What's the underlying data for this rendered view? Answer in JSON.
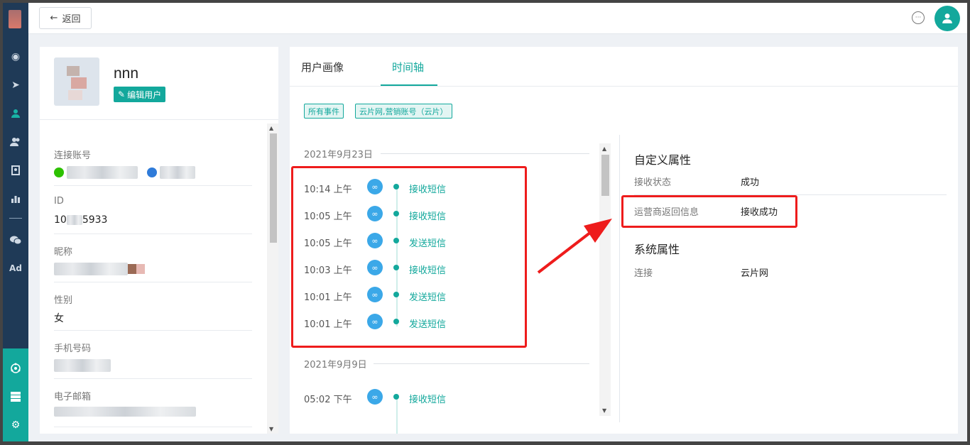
{
  "topbar": {
    "back_label": "返回"
  },
  "profile": {
    "name": "nnn",
    "edit_label": "编辑用户",
    "fields": [
      {
        "label": "连接账号",
        "value": ""
      },
      {
        "label": "ID",
        "value": "10",
        "value_tail": "5933"
      },
      {
        "label": "昵称",
        "value": ""
      },
      {
        "label": "性别",
        "value": "女"
      },
      {
        "label": "手机号码",
        "value": ""
      },
      {
        "label": "电子邮箱",
        "value": ""
      }
    ]
  },
  "main": {
    "tabs": [
      {
        "label": "用户画像"
      },
      {
        "label": "时间轴"
      }
    ],
    "active_tab": "时间轴",
    "tags": [
      "所有事件",
      "云片网,营销账号（云片）"
    ],
    "groups": [
      {
        "date": "2021年9月23日",
        "events": [
          {
            "time": "10:14 上午",
            "label": "接收短信"
          },
          {
            "time": "10:05 上午",
            "label": "接收短信"
          },
          {
            "time": "10:05 上午",
            "label": "发送短信"
          },
          {
            "time": "10:03 上午",
            "label": "接收短信"
          },
          {
            "time": "10:01 上午",
            "label": "发送短信"
          },
          {
            "time": "10:01 上午",
            "label": "发送短信"
          }
        ]
      },
      {
        "date": "2021年9月9日",
        "events": [
          {
            "time": "05:02 下午",
            "label": "接收短信"
          }
        ]
      }
    ],
    "custom_props": {
      "title": "自定义属性",
      "rows": [
        {
          "key": "接收状态",
          "value": "成功"
        },
        {
          "key": "运营商返回信息",
          "value": "接收成功"
        }
      ]
    },
    "system_props": {
      "title": "系统属性",
      "rows": [
        {
          "key": "连接",
          "value": "云片网"
        }
      ]
    }
  },
  "colors": {
    "accent": "#13a89c",
    "nav": "#1f3a57",
    "highlight": "#ee1c1c",
    "event_icon": "#3ba8e8"
  },
  "icons": [
    "back-arrow-icon",
    "chat-icon",
    "user-icon",
    "edit-icon",
    "link-icon",
    "wechat-icon",
    "dashboard-icon",
    "send-icon",
    "group-icon",
    "bookmark-icon",
    "chart-icon",
    "ad-icon",
    "settings-icon"
  ]
}
